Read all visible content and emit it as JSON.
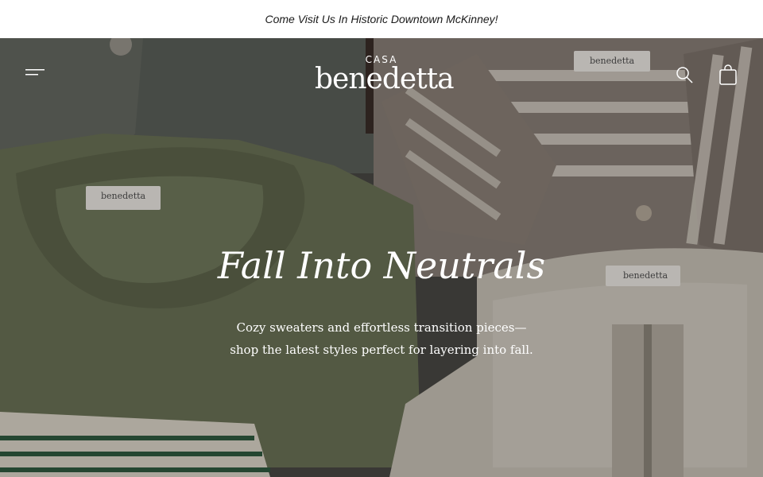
{
  "announcement": {
    "text": "Come Visit Us In Historic Downtown McKinney!"
  },
  "header": {
    "logo_small": "CASA",
    "logo_big": "benedetta",
    "icons": {
      "menu": "hamburger-menu-icon",
      "search": "search-icon",
      "cart": "shopping-bag-icon"
    }
  },
  "hero": {
    "headline": "Fall Into Neutrals",
    "subtext_line1": "Cozy sweaters and effortless transition pieces—",
    "subtext_line2": "shop the latest styles perfect for layering into fall."
  },
  "labels": {
    "tag_text": "benedetta"
  },
  "colors": {
    "olive_sweater": "#6b7256",
    "gray_sweater": "#5c605a",
    "stripe_brown": "#8a7a70",
    "cream": "#e8e4dc",
    "green_stripe": "#2f5a3f"
  }
}
